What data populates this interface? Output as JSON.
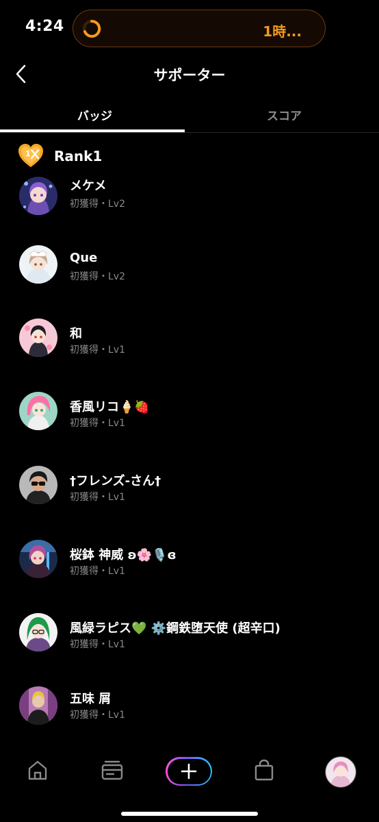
{
  "status_bar": {
    "time": "4:24",
    "live_timer": "1時...",
    "accent_color": "#f59a1b"
  },
  "header": {
    "title": "サポーター",
    "back_icon": "chevron-left-icon"
  },
  "tabs": [
    {
      "label": "バッジ",
      "active": true
    },
    {
      "label": "スコア",
      "active": false
    }
  ],
  "rank": {
    "label": "Rank1",
    "icon": "heart-badge-icon",
    "icon_text": "1"
  },
  "supporters": [
    {
      "name": "メケメ",
      "sub": "初獲得・Lv2"
    },
    {
      "name": "Que",
      "sub": "初獲得・Lv2"
    },
    {
      "name": "和",
      "sub": "初獲得・Lv1"
    },
    {
      "name": "香風リコ🍦🍓",
      "sub": "初獲得・Lv1"
    },
    {
      "name": "†フレンズ-さん†",
      "sub": "初獲得・Lv1"
    },
    {
      "name": "桜鉢 神威 ʚ🌸🎙️ɞ",
      "sub": "初獲得・Lv1"
    },
    {
      "name": "風緑ラピス💚 ⚙️鋼鉄堕天使 (超辛口)",
      "sub": "初獲得・Lv1"
    },
    {
      "name": "五味 屑",
      "sub": "初獲得・Lv1"
    }
  ],
  "bottom_nav": {
    "items": [
      "home-icon",
      "wallet-icon",
      "plus-icon",
      "bag-icon",
      "profile-avatar"
    ]
  }
}
